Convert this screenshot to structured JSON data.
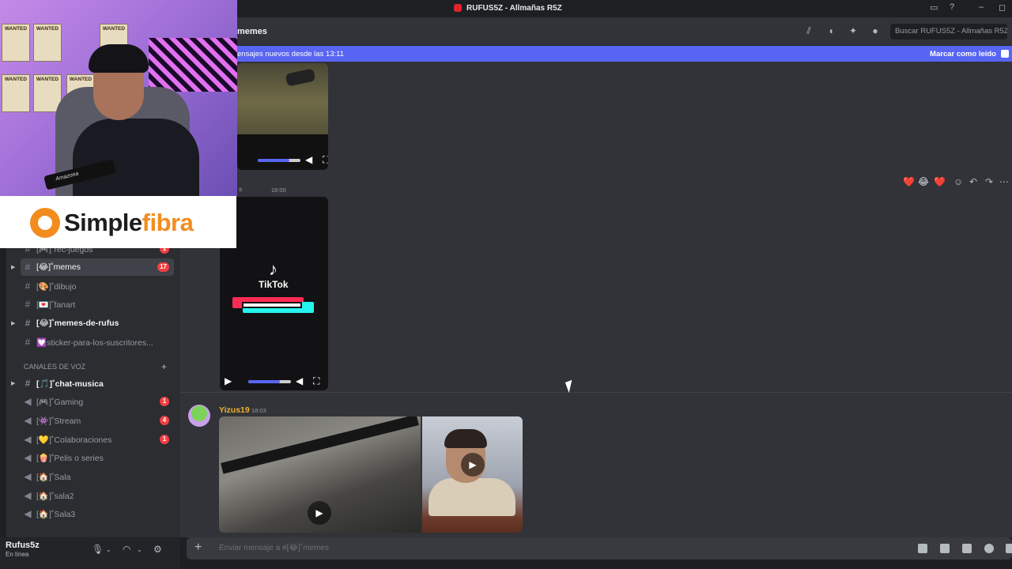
{
  "window": {
    "title": "RUFUS5Z - Allmañas R5Z",
    "controls": {
      "minimize": "–",
      "maximize": "◻"
    }
  },
  "header": {
    "channel_name": "memes",
    "search_placeholder": "Buscar RUFUS5Z - Allmañas R5Z",
    "icons": [
      "threads-icon",
      "bell-icon",
      "pin-icon",
      "members-icon"
    ]
  },
  "new_messages_bar": {
    "text": "ensajes nuevos desde las 13:11",
    "action": "Marcar como leído"
  },
  "sponsor": {
    "brand_part1": "Simple",
    "brand_part2": "fibra"
  },
  "webcam": {
    "posters": [
      "WANTED",
      "WANTED",
      "WANTED",
      "WANTED",
      "WANTED",
      "WANTED"
    ],
    "mic_label": "Amazona"
  },
  "sidebar": {
    "channels": [
      {
        "label": "[🎮]˚rec-juegos",
        "type": "text",
        "badge": "1",
        "state": "normal"
      },
      {
        "label": "[😂]˚memes",
        "type": "text",
        "badge": "17",
        "state": "active"
      },
      {
        "label": "[🎨]˚dibujo",
        "type": "text",
        "badge": "",
        "state": "normal"
      },
      {
        "label": "[💌]˚fanart",
        "type": "text",
        "badge": "",
        "state": "normal"
      },
      {
        "label": "[😂]˚memes-de-rufus",
        "type": "text",
        "badge": "",
        "state": "unread"
      },
      {
        "label": "💟sticker-para-los-suscritores...",
        "type": "text",
        "badge": "",
        "state": "normal"
      },
      {
        "label": "[🎵]˚chat-musica",
        "type": "text",
        "badge": "",
        "state": "unread"
      },
      {
        "label": "[🎮]˚Gaming",
        "type": "voice",
        "badge": "1",
        "state": "normal"
      },
      {
        "label": "[👾]˚Stream",
        "type": "voice",
        "badge": "4",
        "state": "normal"
      },
      {
        "label": "[💛]˚Colaboraciones",
        "type": "voice",
        "badge": "1",
        "state": "normal"
      },
      {
        "label": "[🍿]˚Pelis o series",
        "type": "voice",
        "badge": "",
        "state": "normal"
      },
      {
        "label": "[🏠]˚Sala",
        "type": "voice",
        "badge": "",
        "state": "normal"
      },
      {
        "label": "[🏠]˚sala2",
        "type": "voice",
        "badge": "",
        "state": "normal"
      },
      {
        "label": "[🏠]˚Sala3",
        "type": "voice",
        "badge": "",
        "state": "normal"
      }
    ],
    "voice_category": "CANALES DE VOZ"
  },
  "user_panel": {
    "username": "Rufus5z",
    "status": "En línea"
  },
  "messages": [
    {
      "author": "s",
      "timestamp": "18:00",
      "attachment": "tiktok-video"
    },
    {
      "author": "Yizus19",
      "timestamp": "18:03",
      "attachment": "two-videos"
    }
  ],
  "tiktok": {
    "brand": "TikTok"
  },
  "reactions": [
    "❤️",
    "😂",
    "❤️"
  ],
  "composer": {
    "placeholder": "Enviar mensaje a #[😂]˚memes"
  }
}
